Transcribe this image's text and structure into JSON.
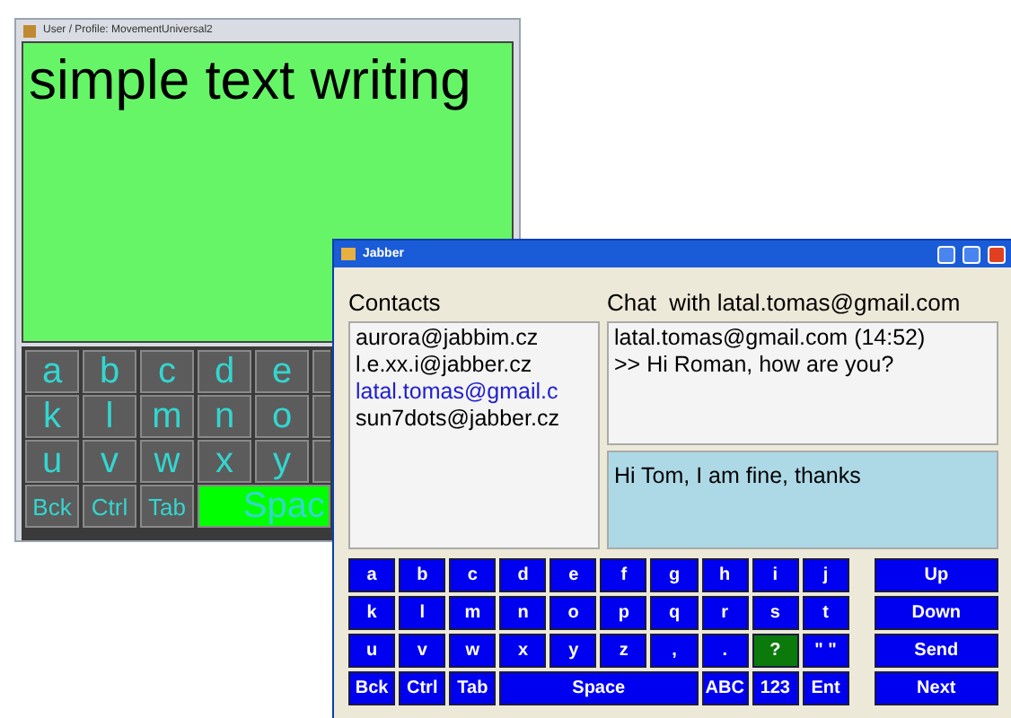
{
  "back_window": {
    "title": "User / Profile: MovementUniversal2",
    "text": "simple text writing",
    "keyboard": [
      [
        {
          "label": "a",
          "kind": "key",
          "highlighted": false
        },
        {
          "label": "b",
          "kind": "key",
          "highlighted": false
        },
        {
          "label": "c",
          "kind": "key",
          "highlighted": false
        },
        {
          "label": "d",
          "kind": "key",
          "highlighted": false
        },
        {
          "label": "e",
          "kind": "key",
          "highlighted": false
        }
      ],
      [
        {
          "label": "k",
          "kind": "key",
          "highlighted": false
        },
        {
          "label": "l",
          "kind": "key",
          "highlighted": false
        },
        {
          "label": "m",
          "kind": "key",
          "highlighted": false
        },
        {
          "label": "n",
          "kind": "key",
          "highlighted": false
        },
        {
          "label": "o",
          "kind": "key",
          "highlighted": false
        }
      ],
      [
        {
          "label": "u",
          "kind": "key",
          "highlighted": false
        },
        {
          "label": "v",
          "kind": "key",
          "highlighted": false
        },
        {
          "label": "w",
          "kind": "key",
          "highlighted": false
        },
        {
          "label": "x",
          "kind": "key",
          "highlighted": false
        },
        {
          "label": "y",
          "kind": "key",
          "highlighted": false
        }
      ],
      [
        {
          "label": "Bck",
          "kind": "small",
          "highlighted": false
        },
        {
          "label": "Ctrl",
          "kind": "small",
          "highlighted": false
        },
        {
          "label": "Tab",
          "kind": "small",
          "highlighted": false
        },
        {
          "label": "Spac",
          "kind": "wide",
          "highlighted": true
        }
      ]
    ]
  },
  "front_window": {
    "title": "Jabber",
    "contacts_label": "Contacts",
    "chat_label": "Chat  with latal.tomas@gmail.com",
    "contacts": [
      {
        "name": "aurora@jabbim.cz",
        "selected": false
      },
      {
        "name": "l.e.xx.i@jabber.cz",
        "selected": false
      },
      {
        "name": "latal.tomas@gmail.c",
        "selected": true
      },
      {
        "name": "sun7dots@jabber.cz",
        "selected": false
      }
    ],
    "chat_history": [
      "latal.tomas@gmail.com (14:52)",
      ">> Hi Roman, how are you?"
    ],
    "message_input": "Hi Tom, I am fine, thanks",
    "keyboard": [
      [
        {
          "label": "a",
          "kind": "key",
          "highlighted": false
        },
        {
          "label": "b",
          "kind": "key",
          "highlighted": false
        },
        {
          "label": "c",
          "kind": "key",
          "highlighted": false
        },
        {
          "label": "d",
          "kind": "key",
          "highlighted": false
        },
        {
          "label": "e",
          "kind": "key",
          "highlighted": false
        },
        {
          "label": "f",
          "kind": "key",
          "highlighted": false
        },
        {
          "label": "g",
          "kind": "key",
          "highlighted": false
        },
        {
          "label": "h",
          "kind": "key",
          "highlighted": false
        },
        {
          "label": "i",
          "kind": "key",
          "highlighted": false
        },
        {
          "label": "j",
          "kind": "key",
          "highlighted": false
        }
      ],
      [
        {
          "label": "k",
          "kind": "key",
          "highlighted": false
        },
        {
          "label": "l",
          "kind": "key",
          "highlighted": false
        },
        {
          "label": "m",
          "kind": "key",
          "highlighted": false
        },
        {
          "label": "n",
          "kind": "key",
          "highlighted": false
        },
        {
          "label": "o",
          "kind": "key",
          "highlighted": false
        },
        {
          "label": "p",
          "kind": "key",
          "highlighted": false
        },
        {
          "label": "q",
          "kind": "key",
          "highlighted": false
        },
        {
          "label": "r",
          "kind": "key",
          "highlighted": false
        },
        {
          "label": "s",
          "kind": "key",
          "highlighted": false
        },
        {
          "label": "t",
          "kind": "key",
          "highlighted": false
        }
      ],
      [
        {
          "label": "u",
          "kind": "key",
          "highlighted": false
        },
        {
          "label": "v",
          "kind": "key",
          "highlighted": false
        },
        {
          "label": "w",
          "kind": "key",
          "highlighted": false
        },
        {
          "label": "x",
          "kind": "key",
          "highlighted": false
        },
        {
          "label": "y",
          "kind": "key",
          "highlighted": false
        },
        {
          "label": "z",
          "kind": "key",
          "highlighted": false
        },
        {
          "label": ",",
          "kind": "key",
          "highlighted": false
        },
        {
          "label": ".",
          "kind": "key",
          "highlighted": false
        },
        {
          "label": "?",
          "kind": "key",
          "highlighted": true
        },
        {
          "label": "\" \"",
          "kind": "key",
          "highlighted": false
        }
      ],
      [
        {
          "label": "Bck",
          "kind": "key",
          "highlighted": false
        },
        {
          "label": "Ctrl",
          "kind": "key",
          "highlighted": false
        },
        {
          "label": "Tab",
          "kind": "key",
          "highlighted": false
        },
        {
          "label": "Space",
          "kind": "wide",
          "highlighted": false
        },
        {
          "label": "ABC",
          "kind": "key",
          "highlighted": false
        },
        {
          "label": "123",
          "kind": "key",
          "highlighted": false
        },
        {
          "label": "Ent",
          "kind": "key",
          "highlighted": false
        }
      ]
    ],
    "nav_buttons": [
      "Up",
      "Down",
      "Send",
      "Next"
    ]
  }
}
